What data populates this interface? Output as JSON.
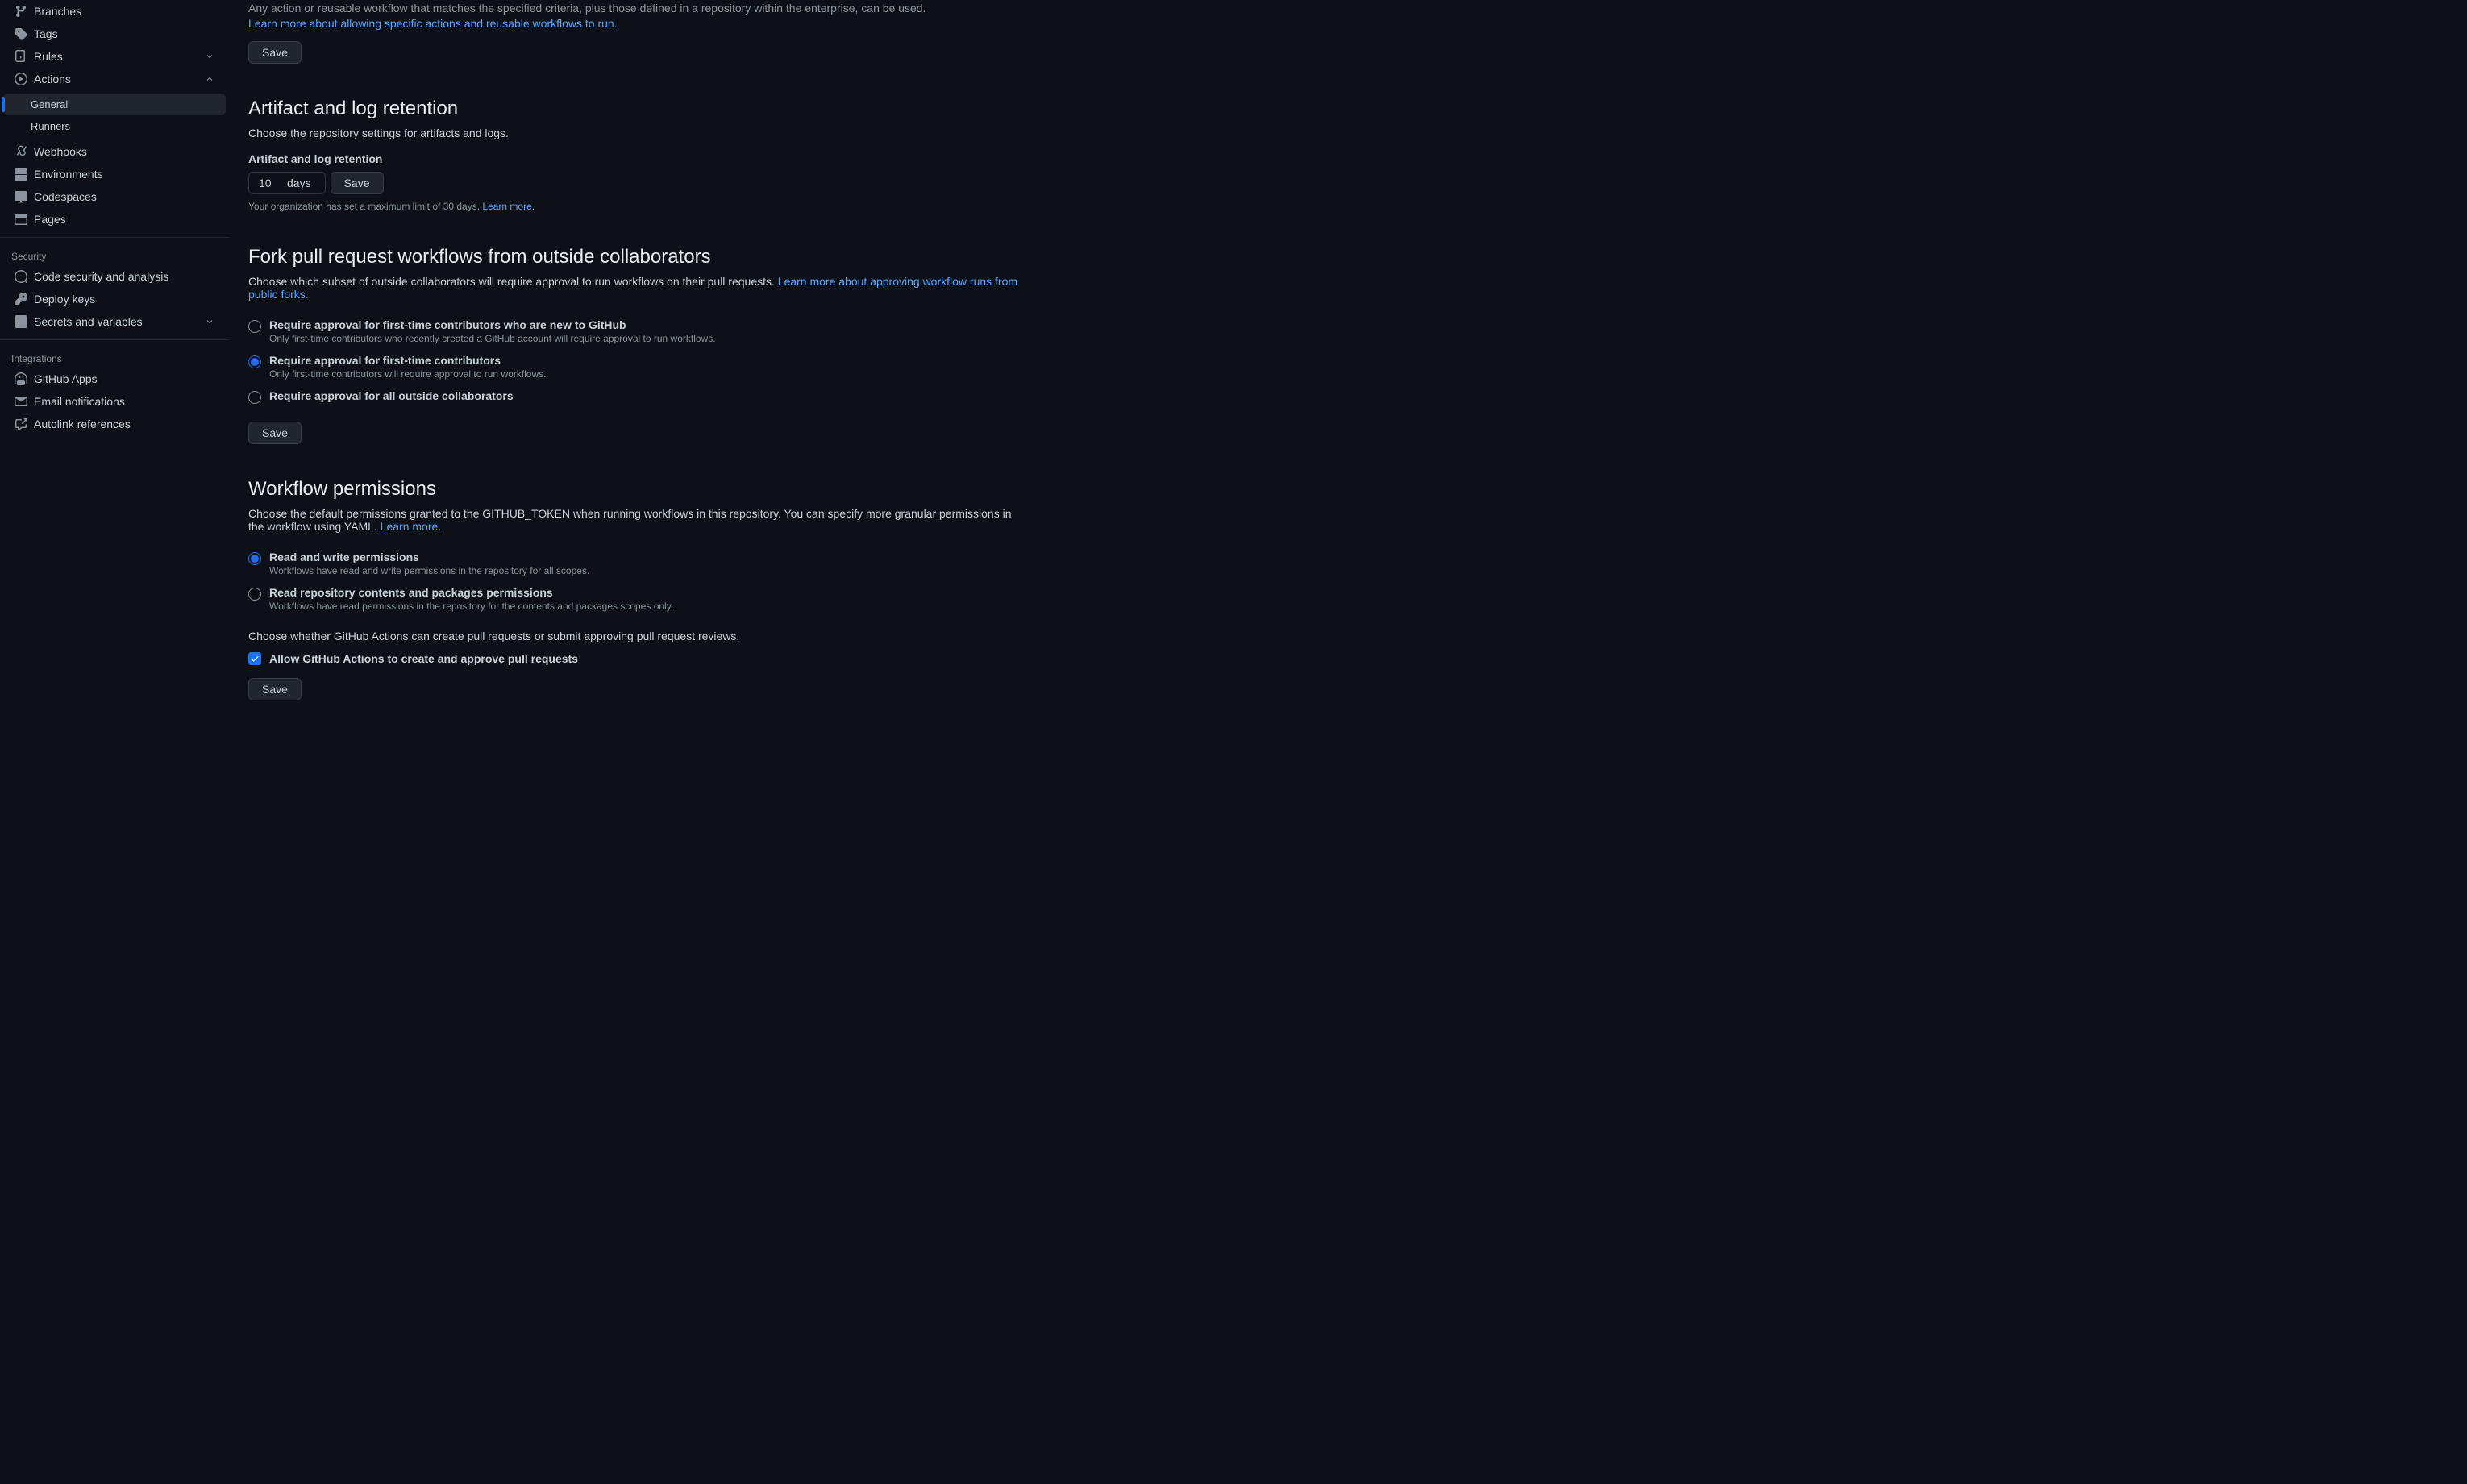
{
  "sidebar": {
    "items": [
      {
        "label": "Branches"
      },
      {
        "label": "Tags"
      },
      {
        "label": "Rules"
      },
      {
        "label": "Actions"
      }
    ],
    "actions_sub": [
      {
        "label": "General",
        "active": true
      },
      {
        "label": "Runners",
        "active": false
      }
    ],
    "after_actions": [
      {
        "label": "Webhooks"
      },
      {
        "label": "Environments"
      },
      {
        "label": "Codespaces"
      },
      {
        "label": "Pages"
      }
    ],
    "security_label": "Security",
    "security": [
      {
        "label": "Code security and analysis"
      },
      {
        "label": "Deploy keys"
      },
      {
        "label": "Secrets and variables"
      }
    ],
    "integrations_label": "Integrations",
    "integrations": [
      {
        "label": "GitHub Apps"
      },
      {
        "label": "Email notifications"
      },
      {
        "label": "Autolink references"
      }
    ]
  },
  "actions_policy": {
    "desc": "Any action or reusable workflow that matches the specified criteria, plus those defined in a repository within the enterprise, can be used.",
    "link": "Learn more about allowing specific actions and reusable workflows to run.",
    "save": "Save"
  },
  "retention": {
    "heading": "Artifact and log retention",
    "desc": "Choose the repository settings for artifacts and logs.",
    "label": "Artifact and log retention",
    "value": "10",
    "unit": "days",
    "save": "Save",
    "hint_prefix": "Your organization has set a maximum limit of 30 days. ",
    "hint_link": "Learn more."
  },
  "fork": {
    "heading": "Fork pull request workflows from outside collaborators",
    "desc": "Choose which subset of outside collaborators will require approval to run workflows on their pull requests. ",
    "link": "Learn more about approving workflow runs from public forks.",
    "options": [
      {
        "label": "Require approval for first-time contributors who are new to GitHub",
        "desc": "Only first-time contributors who recently created a GitHub account will require approval to run workflows.",
        "checked": false
      },
      {
        "label": "Require approval for first-time contributors",
        "desc": "Only first-time contributors will require approval to run workflows.",
        "checked": true
      },
      {
        "label": "Require approval for all outside collaborators",
        "desc": "",
        "checked": false
      }
    ],
    "save": "Save"
  },
  "workflow": {
    "heading": "Workflow permissions",
    "desc": "Choose the default permissions granted to the GITHUB_TOKEN when running workflows in this repository. You can specify more granular permissions in the workflow using YAML. ",
    "link": "Learn more.",
    "options": [
      {
        "label": "Read and write permissions",
        "desc": "Workflows have read and write permissions in the repository for all scopes.",
        "checked": true
      },
      {
        "label": "Read repository contents and packages permissions",
        "desc": "Workflows have read permissions in the repository for the contents and packages scopes only.",
        "checked": false
      }
    ],
    "choose_pr": "Choose whether GitHub Actions can create pull requests or submit approving pull request reviews.",
    "allow_pr_label": "Allow GitHub Actions to create and approve pull requests",
    "save": "Save"
  }
}
